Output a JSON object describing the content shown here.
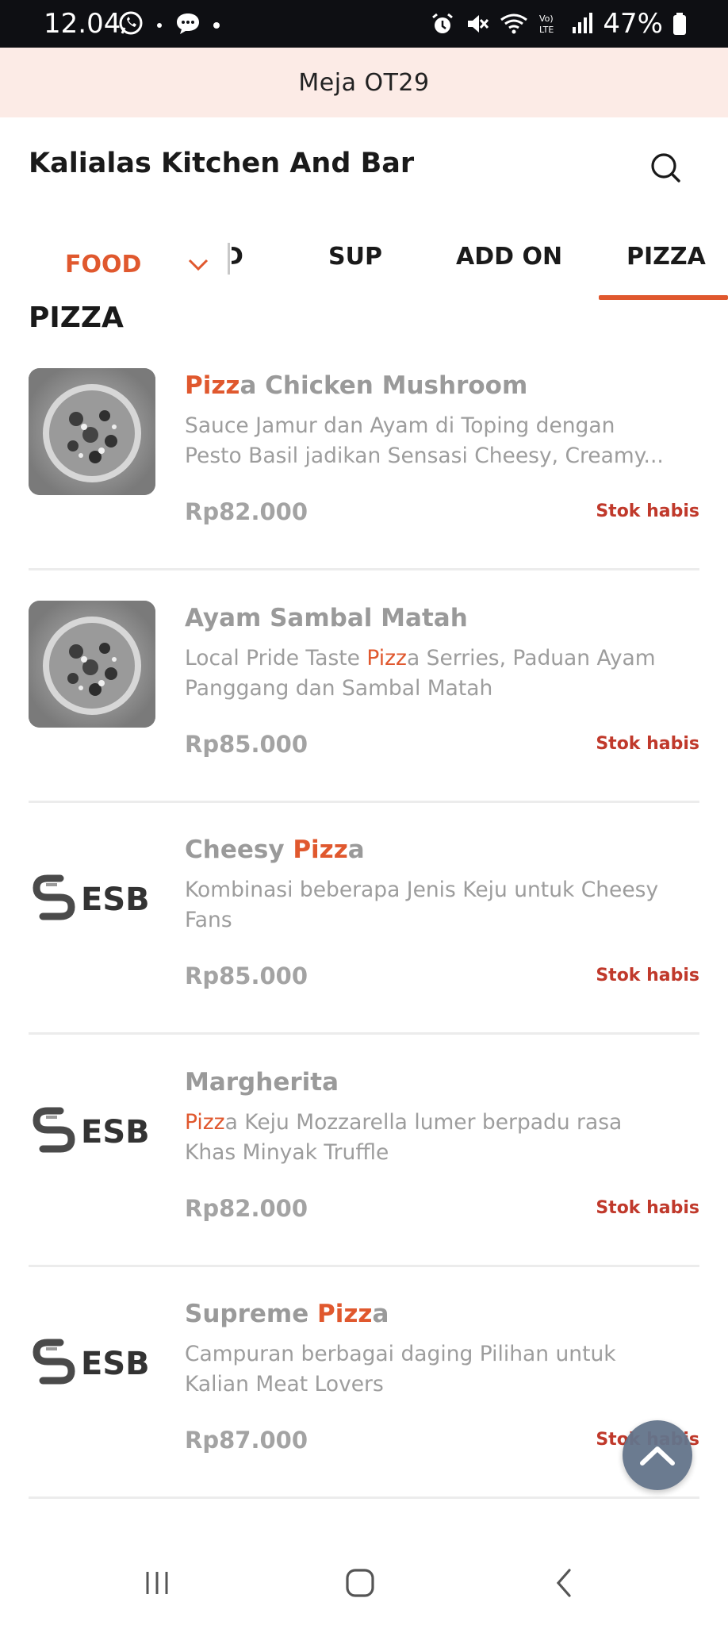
{
  "status_bar": {
    "time": "12.04",
    "battery": "47%",
    "icons": [
      "whatsapp-icon",
      "dot-icon",
      "chat-bubble-icon",
      "dot-icon",
      "alarm-icon",
      "mute-icon",
      "wifi-icon",
      "volte-icon",
      "signal-icon",
      "battery-icon"
    ]
  },
  "table_banner": "Meja OT29",
  "header": {
    "store_name": "Kalialas Kitchen And Bar",
    "search_icon": "search-icon"
  },
  "category_bar": {
    "dropdown_label": "FOOD",
    "tabs": [
      {
        "label": "D",
        "active": false
      },
      {
        "label": "SUP",
        "active": false
      },
      {
        "label": "ADD ON",
        "active": false
      },
      {
        "label": "PIZZA",
        "active": true
      }
    ],
    "active_color": "#e0582e"
  },
  "section_title": "PIZZA",
  "search_highlight": "Pizz",
  "menu_items": [
    {
      "name_pre": "",
      "name_hl": "Pizz",
      "name_post": "a Chicken Mushroom",
      "desc_pre": "Sauce Jamur dan Ayam di Toping dengan Pesto Basil jadikan Sensasi Cheesy, Creamy...",
      "desc_hl": "",
      "desc_post": "",
      "price": "Rp82.000",
      "stock": "Stok habis",
      "image": "pizza-photo"
    },
    {
      "name_pre": "Ayam Sambal Matah",
      "name_hl": "",
      "name_post": "",
      "desc_pre": "Local Pride Taste ",
      "desc_hl": "Pizz",
      "desc_post": "a Serries, Paduan Ayam Panggang dan Sambal Matah",
      "price": "Rp85.000",
      "stock": "Stok habis",
      "image": "pizza-photo"
    },
    {
      "name_pre": "Cheesy ",
      "name_hl": "Pizz",
      "name_post": "a",
      "desc_pre": "Kombinasi beberapa Jenis Keju untuk Cheesy Fans",
      "desc_hl": "",
      "desc_post": "",
      "price": "Rp85.000",
      "stock": "Stok habis",
      "image": "esb-logo"
    },
    {
      "name_pre": "Margherita",
      "name_hl": "",
      "name_post": "",
      "desc_pre": "",
      "desc_hl": "Pizz",
      "desc_post": "a Keju Mozzarella lumer berpadu rasa Khas Minyak Truffle",
      "price": "Rp82.000",
      "stock": "Stok habis",
      "image": "esb-logo"
    },
    {
      "name_pre": "Supreme ",
      "name_hl": "Pizz",
      "name_post": "a",
      "desc_pre": "Campuran berbagai daging Pilihan untuk Kalian Meat Lovers",
      "desc_hl": "",
      "desc_post": "",
      "price": "Rp87.000",
      "stock": "Stok habis",
      "image": "esb-logo"
    }
  ],
  "esb_logo_text": "ESB",
  "floating_button": "chevron-up-icon",
  "nav_bar": [
    "recent-apps-icon",
    "home-icon",
    "back-icon"
  ]
}
